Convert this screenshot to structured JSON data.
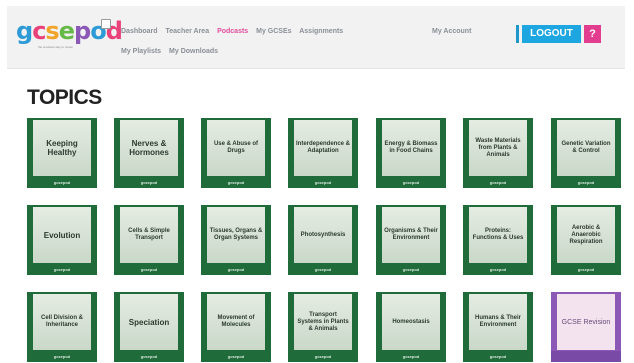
{
  "header": {
    "logo_text": "gcsepod",
    "logo_tagline": "the smartest way to revise",
    "nav_primary": [
      "Dashboard",
      "Teacher Area",
      "Podcasts",
      "My GCSEs",
      "Assignments"
    ],
    "nav_secondary": [
      "My Playlists",
      "My Downloads"
    ],
    "account_label": "My Account",
    "logout_label": "LOGOUT",
    "help_label": "?"
  },
  "page": {
    "title": "TOPICS"
  },
  "topics": [
    {
      "label": "Keeping Healthy",
      "footer": "gcsepod"
    },
    {
      "label": "Nerves & Hormones",
      "footer": "gcsepod"
    },
    {
      "label": "Use & Abuse of Drugs",
      "footer": "gcsepod"
    },
    {
      "label": "Interdependence & Adaptation",
      "footer": "gcsepod"
    },
    {
      "label": "Energy & Biomass in Food Chains",
      "footer": "gcsepod"
    },
    {
      "label": "Waste Materials from Plants & Animals",
      "footer": "gcsepod"
    },
    {
      "label": "Genetic Variation & Control",
      "footer": "gcsepod"
    },
    {
      "label": "Evolution",
      "footer": "gcsepod"
    },
    {
      "label": "Cells & Simple Transport",
      "footer": "gcsepod"
    },
    {
      "label": "Tissues, Organs & Organ Systems",
      "footer": "gcsepod"
    },
    {
      "label": "Photosynthesis",
      "footer": "gcsepod"
    },
    {
      "label": "Organisms & Their Environment",
      "footer": "gcsepod"
    },
    {
      "label": "Proteins: Functions & Uses",
      "footer": "gcsepod"
    },
    {
      "label": "Aerobic & Anaerobic Respiration",
      "footer": "gcsepod"
    },
    {
      "label": "Cell Division & Inheritance",
      "footer": "gcsepod"
    },
    {
      "label": "Speciation",
      "footer": "gcsepod"
    },
    {
      "label": "Movement of Molecules",
      "footer": "gcsepod"
    },
    {
      "label": "Transport Systems in Plants & Animals",
      "footer": "gcsepod"
    },
    {
      "label": "Homeostasis",
      "footer": "gcsepod"
    },
    {
      "label": "Humans & Their Environment",
      "footer": "gcsepod"
    },
    {
      "label": "GCSE Revision",
      "footer": ""
    }
  ],
  "colors": {
    "tile_green": "#1f6b3a",
    "tile_purple": "#8b58b6",
    "logout_blue": "#1ea6e0",
    "help_pink": "#e23d8f",
    "nav_active": "#e24d9a"
  }
}
